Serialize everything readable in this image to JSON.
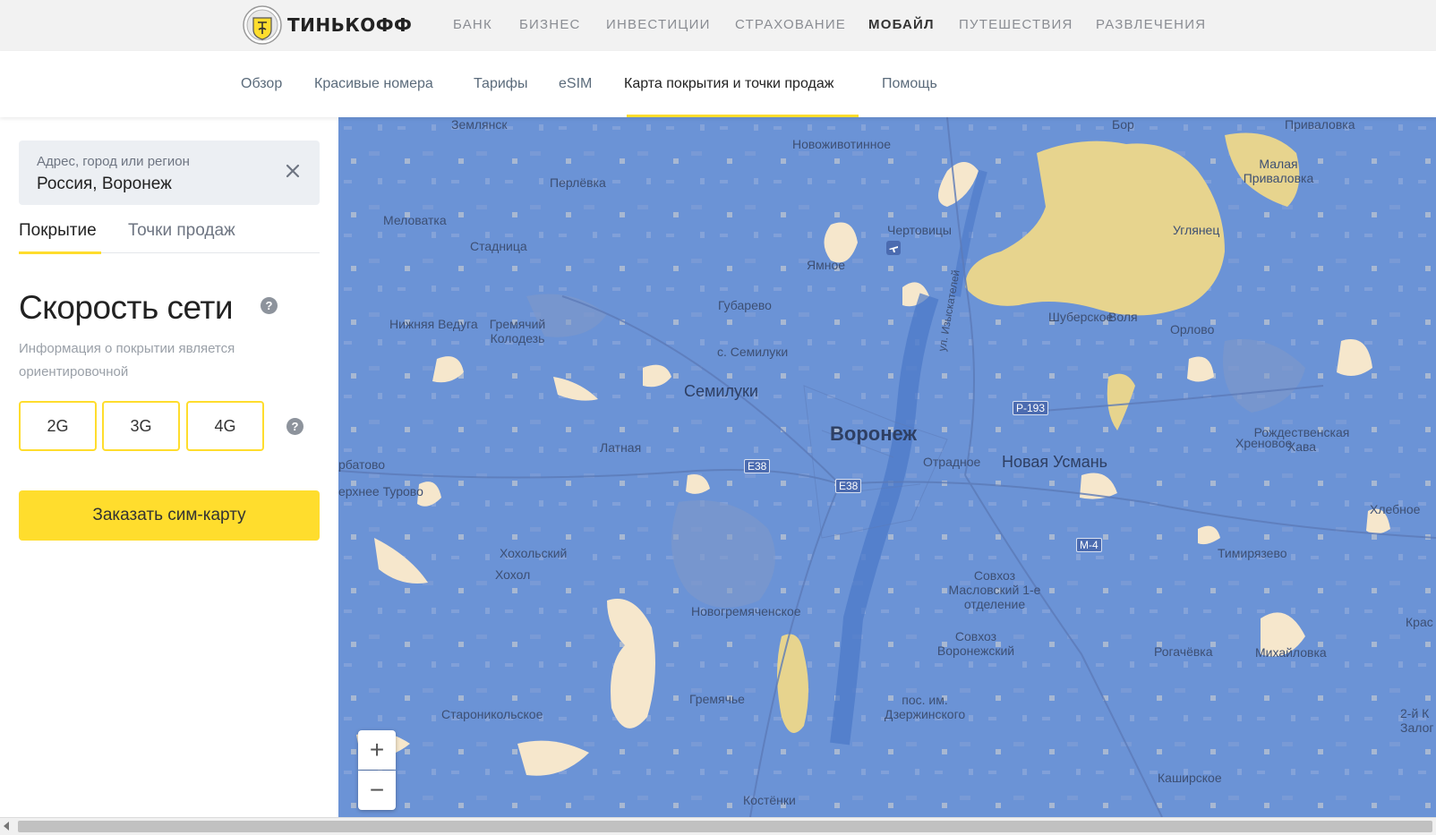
{
  "brand": {
    "name": "ТИНЬКОФФ"
  },
  "topnav": [
    {
      "label": "БАНК"
    },
    {
      "label": "БИЗНЕС"
    },
    {
      "label": "ИНВЕСТИЦИИ"
    },
    {
      "label": "СТРАХОВАНИЕ"
    },
    {
      "label": "МОБАЙЛ",
      "active": true
    },
    {
      "label": "ПУТЕШЕСТВИЯ"
    },
    {
      "label": "РАЗВЛЕЧЕНИЯ"
    }
  ],
  "subnav": [
    {
      "label": "Обзор"
    },
    {
      "label": "Красивые номера"
    },
    {
      "label": "Тарифы"
    },
    {
      "label": "eSIM"
    },
    {
      "label": "Карта покрытия и точки продаж",
      "active": true
    },
    {
      "label": "Помощь"
    }
  ],
  "sidebar": {
    "search": {
      "placeholder": "Адрес, город или регион",
      "value": "Россия, Воронеж"
    },
    "tabs": [
      {
        "label": "Покрытие",
        "active": true
      },
      {
        "label": "Точки продаж"
      }
    ],
    "speed_title": "Скорость сети",
    "help_glyph": "?",
    "note": "Информация о покрытии является ориентировочной",
    "networks": [
      {
        "label": "2G"
      },
      {
        "label": "3G"
      },
      {
        "label": "4G"
      }
    ],
    "order_button": "Заказать сим-карту"
  },
  "map": {
    "zoom_in": "+",
    "zoom_out": "−",
    "colors": {
      "coverage_4g": "#6b93d6",
      "coverage_3g": "#e7d48e",
      "coverage_2g": "#f6e7cc",
      "water": "#4a77c7"
    },
    "labels": [
      "Землянск",
      "Новоживотинное",
      "Бор",
      "Приваловка",
      "Малая Приваловка",
      "Перлёвка",
      "Меловатка",
      "Чертовицы",
      "Углянец",
      "Стадница",
      "Ямное",
      "Губарево",
      "Шуберское",
      "Воля",
      "Нижняя Ведуга",
      "Гремячий Колодезь",
      "Орлово",
      "с. Семилуки",
      "Семилуки",
      "ул. Изыскателей",
      "Воронеж",
      "Латная",
      "Отрадное",
      "Новая Усмань",
      "Хреновое",
      "Рождественская Хава",
      "рбатово",
      "ерхнее Турово",
      "Хлебное",
      "Хохольский",
      "Хохол",
      "Совхоз Масловский 1-е отделение",
      "Тимирязево",
      "Новогремяченское",
      "Совхоз Воронежский",
      "Рогачёвка",
      "Михайловка",
      "Крас",
      "Гремячье",
      "пос. им. Дзержинского",
      "Староникольское",
      "2-й К",
      "Залог",
      "Каширское",
      "Костёнки"
    ],
    "shields": [
      "E38",
      "E38",
      "Р-193",
      "М-4"
    ]
  }
}
